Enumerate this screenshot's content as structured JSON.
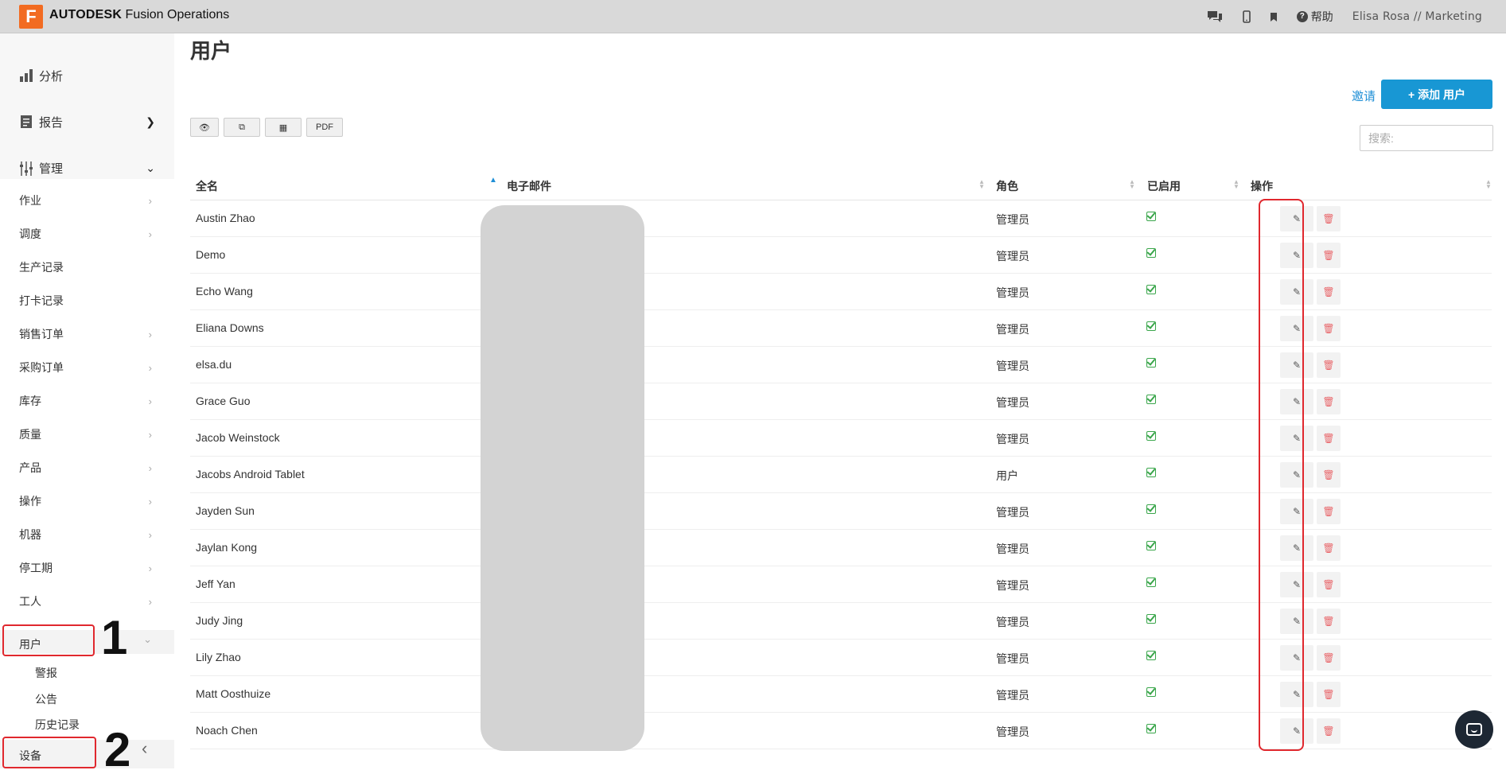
{
  "topbar": {
    "logo_letter": "F",
    "brand_bold": "AUTODESK",
    "brand_rest": "Fusion Operations",
    "help_label": "帮助",
    "user": "Elisa Rosa // Marketing",
    "icons": [
      "chat-icon",
      "mobile-icon",
      "bookmark-icon",
      "help-icon"
    ]
  },
  "sidebar": {
    "analysis": "分析",
    "reports": "报告",
    "manage": "管理",
    "items": [
      {
        "label": "作业",
        "chevron": "›"
      },
      {
        "label": "调度",
        "chevron": "›"
      },
      {
        "label": "生产记录",
        "chevron": ""
      },
      {
        "label": "打卡记录",
        "chevron": ""
      },
      {
        "label": "销售订单",
        "chevron": "›"
      },
      {
        "label": "采购订单",
        "chevron": "›"
      },
      {
        "label": "库存",
        "chevron": "›"
      },
      {
        "label": "质量",
        "chevron": "›"
      },
      {
        "label": "产品",
        "chevron": "›"
      },
      {
        "label": "操作",
        "chevron": "›"
      },
      {
        "label": "机器",
        "chevron": "›"
      },
      {
        "label": "停工期",
        "chevron": "›"
      },
      {
        "label": "工人",
        "chevron": "›"
      },
      {
        "label": "用户",
        "chevron": "⌄"
      }
    ],
    "sub_items": [
      "警报",
      "公告",
      "历史记录"
    ],
    "devices": "设备",
    "callout_1": "1",
    "callout_2": "2",
    "collapse": "‹"
  },
  "main": {
    "title": "用户",
    "invite": "邀请",
    "add_user": "添加 用户",
    "add_plus": "+",
    "tools": [
      "👁",
      "⧉",
      "▦",
      "PDF"
    ],
    "search_placeholder": "搜索:",
    "columns": [
      "全名",
      "电子邮件",
      "角色",
      "已启用",
      "操作"
    ]
  },
  "table": {
    "rows": [
      {
        "name": "Austin Zhao",
        "role": "管理员",
        "enabled": true
      },
      {
        "name": "Demo",
        "role": "管理员",
        "enabled": true
      },
      {
        "name": "Echo Wang",
        "role": "管理员",
        "enabled": true
      },
      {
        "name": "Eliana Downs",
        "role": "管理员",
        "enabled": true
      },
      {
        "name": "elsa.du",
        "role": "管理员",
        "enabled": true
      },
      {
        "name": "Grace Guo",
        "role": "管理员",
        "enabled": true
      },
      {
        "name": "Jacob Weinstock",
        "role": "管理员",
        "enabled": true
      },
      {
        "name": "Jacobs Android Tablet",
        "role": "用户",
        "enabled": true
      },
      {
        "name": "Jayden Sun",
        "role": "管理员",
        "enabled": true
      },
      {
        "name": "Jaylan Kong",
        "role": "管理员",
        "enabled": true
      },
      {
        "name": "Jeff Yan",
        "role": "管理员",
        "enabled": true
      },
      {
        "name": "Judy Jing",
        "role": "管理员",
        "enabled": true
      },
      {
        "name": "Lily Zhao",
        "role": "管理员",
        "enabled": true
      },
      {
        "name": "Matt Oosthuize",
        "role": "管理员",
        "enabled": true
      },
      {
        "name": "Noach Chen",
        "role": "管理员",
        "enabled": true
      }
    ],
    "edit_icon": "✎",
    "delete_icon": "🗑"
  }
}
